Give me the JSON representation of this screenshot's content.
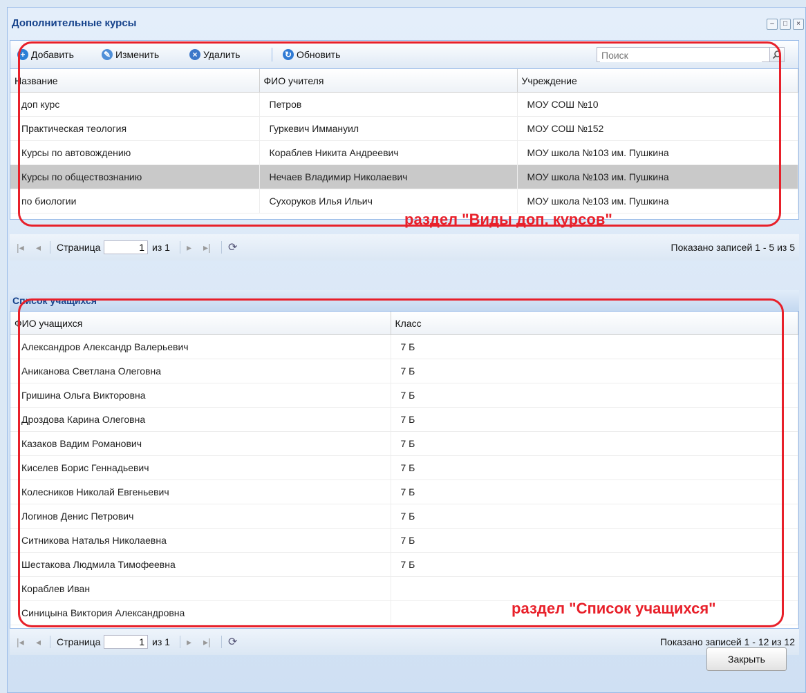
{
  "window": {
    "title": "Дополнительные курсы",
    "minimize_symbol": "–",
    "maximize_symbol": "□",
    "close_symbol": "×"
  },
  "toolbar": {
    "add_label": "Добавить",
    "edit_label": "Изменить",
    "delete_label": "Удалить",
    "refresh_label": "Обновить",
    "search_placeholder": "Поиск",
    "icons": [
      "add-icon",
      "edit-icon",
      "delete-icon",
      "refresh-icon",
      "search-icon"
    ]
  },
  "courses": {
    "columns": [
      "Название",
      "ФИО учителя",
      "Учреждение"
    ],
    "rows": [
      [
        "доп курс",
        "Петров",
        "МОУ СОШ №10"
      ],
      [
        "Практическая теология",
        "Гуркевич Иммануил",
        "МОУ СОШ №152"
      ],
      [
        "Курсы по автовождению",
        "Кораблев Никита Андреевич",
        "МОУ школа №103 им. Пушкина"
      ],
      [
        "Курсы по обществознанию",
        "Нечаев Владимир Николаевич",
        "МОУ школа №103 им. Пушкина"
      ],
      [
        "по биологии",
        "Сухоруков Илья Ильич",
        "МОУ школа №103 им. Пушкина"
      ]
    ],
    "selected_row": 3,
    "annotation": "раздел \"Виды доп. курсов\""
  },
  "paging_courses": {
    "page_label": "Страница",
    "page_value": "1",
    "of_label": "из 1",
    "summary": "Показано записей 1 - 5 из 5"
  },
  "students": {
    "title": "Список учащихся",
    "columns": [
      "ФИО учащихся",
      "Класс"
    ],
    "rows": [
      [
        "Александров Александр Валерьевич",
        "7 Б"
      ],
      [
        "Аниканова Светлана Олеговна",
        "7 Б"
      ],
      [
        "Гришина Ольга Викторовна",
        "7 Б"
      ],
      [
        "Дроздова Карина Олеговна",
        "7 Б"
      ],
      [
        "Казаков Вадим Романович",
        "7 Б"
      ],
      [
        "Киселев Борис Геннадьевич",
        "7 Б"
      ],
      [
        "Колесников Николай Евгеньевич",
        "7 Б"
      ],
      [
        "Логинов Денис Петрович",
        "7 Б"
      ],
      [
        "Ситникова Наталья Николаевна",
        "7 Б"
      ],
      [
        "Шестакова Людмила Тимофеевна",
        "7 Б"
      ],
      [
        "Кораблев Иван",
        ""
      ],
      [
        "Синицына Виктория Александровна",
        ""
      ]
    ],
    "annotation": "раздел \"Список учащихся\""
  },
  "paging_students": {
    "page_label": "Страница",
    "page_value": "1",
    "of_label": "из 1",
    "summary": "Показано записей 1 - 12 из 12"
  },
  "footer": {
    "close_label": "Закрыть"
  },
  "colors": {
    "accent_red": "#e8202a",
    "header_text": "#15428b",
    "selected_row": "#c9c9c9"
  }
}
